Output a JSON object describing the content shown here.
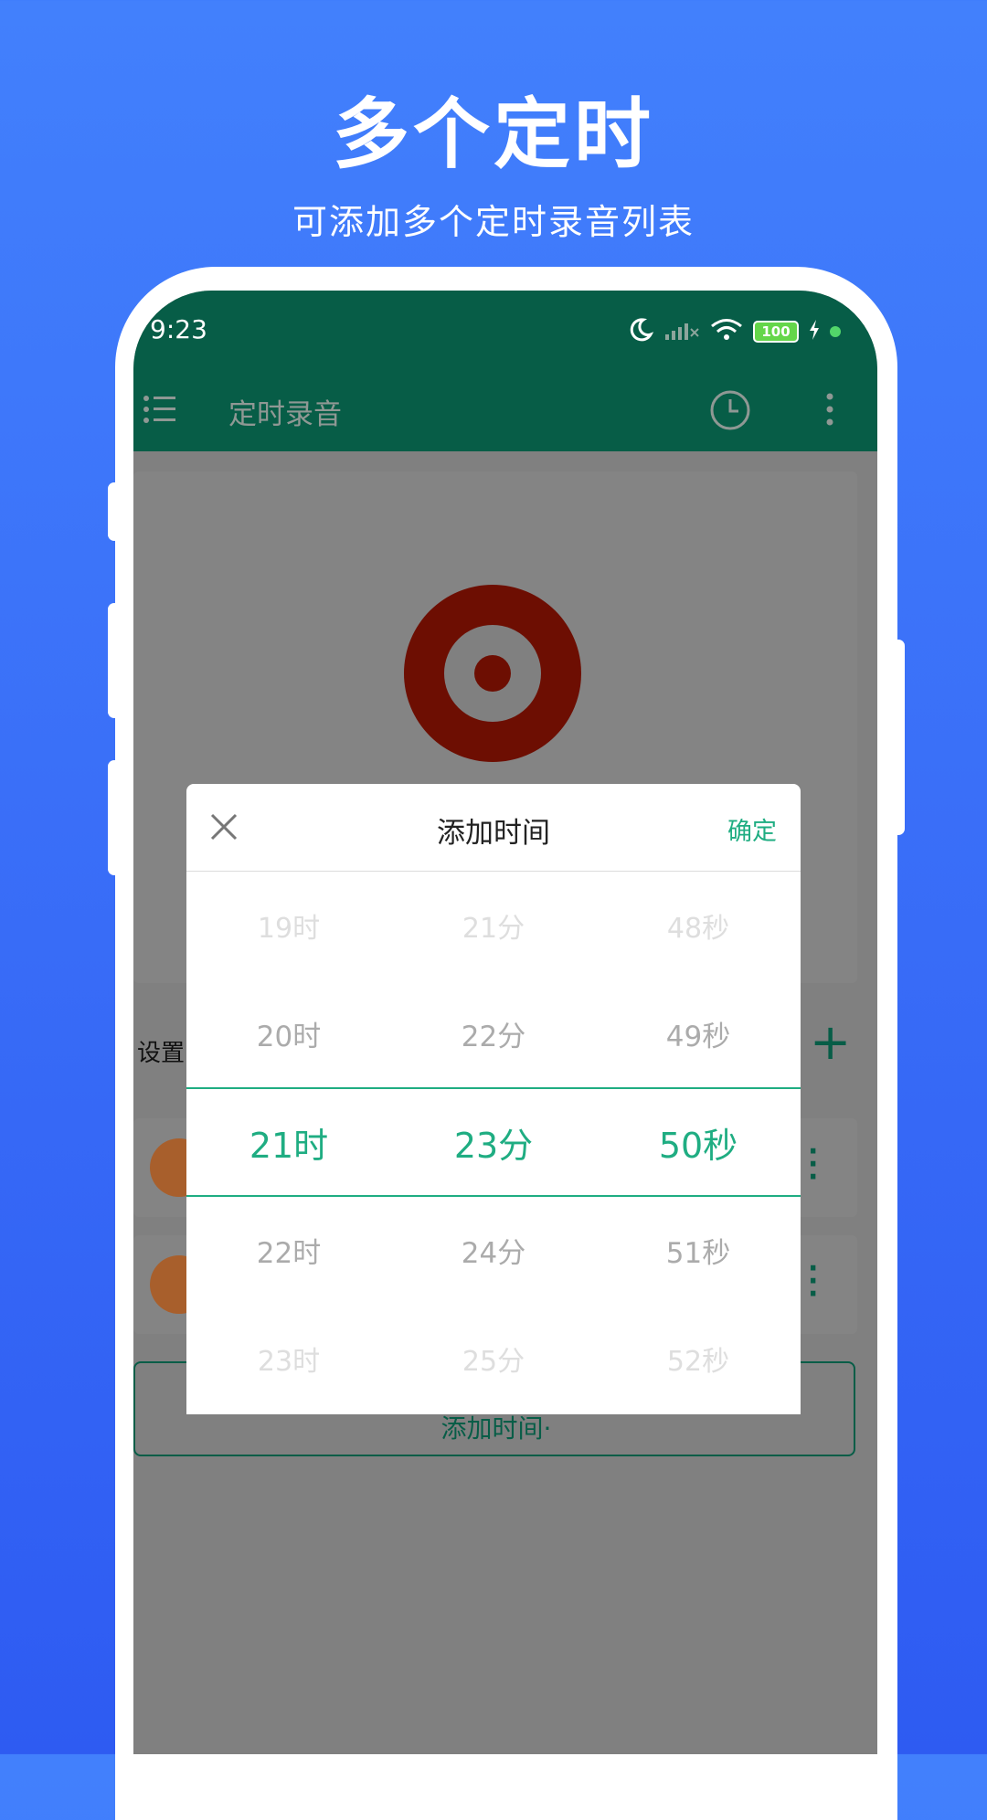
{
  "promo": {
    "title": "多个定时",
    "subtitle": "可添加多个定时录音列表"
  },
  "status_bar": {
    "time": "9:23",
    "battery": "100",
    "icons": [
      "moon-icon",
      "signal-icon",
      "wifi-icon",
      "battery-icon",
      "charging-icon"
    ]
  },
  "app_bar": {
    "title": "定时录音",
    "icons": [
      "menu-icon",
      "clock-icon",
      "more-vert-icon"
    ]
  },
  "main": {
    "section_label": "设置",
    "add_button_partial": "添加时间·"
  },
  "dialog": {
    "title": "添加时间",
    "confirm": "确定",
    "columns": {
      "hours": [
        "19时",
        "20时",
        "21时",
        "22时",
        "23时"
      ],
      "minutes": [
        "21分",
        "22分",
        "23分",
        "24分",
        "25分"
      ],
      "seconds": [
        "48秒",
        "49秒",
        "50秒",
        "51秒",
        "52秒"
      ]
    },
    "selected": {
      "hour": "21时",
      "minute": "23分",
      "second": "50秒"
    }
  },
  "colors": {
    "background_top": "#4280fc",
    "background_bottom": "#2e5bf2",
    "app_bar": "#075d47",
    "accent": "#1fad82",
    "record": "#6d0e02",
    "overlay": "#808080"
  }
}
